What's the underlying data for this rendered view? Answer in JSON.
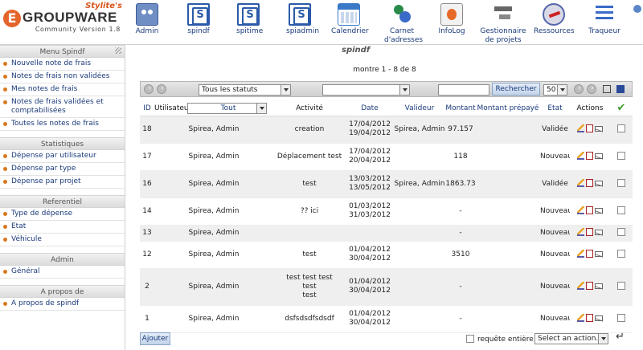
{
  "logo": {
    "tagline": "Stylite's",
    "letter": "E",
    "name": "GROUPWARE",
    "version": "Community Version 1.8"
  },
  "apps": [
    {
      "label": "Admin",
      "icon": "admin-icon"
    },
    {
      "label": "spindf",
      "icon": "spindf-icon"
    },
    {
      "label": "spitime",
      "icon": "spitime-icon"
    },
    {
      "label": "spiadmin",
      "icon": "spiadmin-icon"
    },
    {
      "label": "Calendrier",
      "icon": "calendar-icon"
    },
    {
      "label": "Carnet",
      "label2": "d'adresses",
      "icon": "addressbook-icon"
    },
    {
      "label": "InfoLog",
      "icon": "infolog-icon"
    },
    {
      "label": "Gestionnaire",
      "label2": "de projets",
      "icon": "projectmanager-icon"
    },
    {
      "label": "Ressources",
      "icon": "resources-icon"
    },
    {
      "label": "Traqueur",
      "icon": "tracker-icon"
    }
  ],
  "app_title": "spindf",
  "sidebar": {
    "sections": [
      {
        "title": "Menu Spindf",
        "items": [
          "Nouvelle note de frais",
          "Notes de frais non validées",
          "Mes notes de frais",
          "Notes de frais validées et comptabilisées",
          "Toutes les notes de frais"
        ]
      },
      {
        "title": "Statistiques",
        "items": [
          "Dépense par utilisateur",
          "Dépense par type",
          "Dépense par projet"
        ]
      },
      {
        "title": "Referentiel",
        "items": [
          "Type de dépense",
          "Etat",
          "Véhicule"
        ]
      },
      {
        "title": "Admin",
        "items": [
          "Général"
        ]
      },
      {
        "title": "A propos de",
        "items": [
          "A propos de spindf"
        ]
      }
    ]
  },
  "list": {
    "count_text": "montre 1 - 8 de 8",
    "status_filter": "Tous les statuts",
    "second_filter": "",
    "search_value": "",
    "search_button": "Rechercher",
    "page_size": "50",
    "columns": {
      "id": "ID",
      "user_label": "Utilisateur",
      "user_filter": "Tout",
      "activity": "Activité",
      "date": "Date",
      "validator": "Valideur",
      "amount": "Montant",
      "prepaid": "Montant prépayé",
      "state": "Etat",
      "actions": "Actions",
      "select_all_icon": "checkmark-icon"
    },
    "rows": [
      {
        "id": "18",
        "user": "Spirea, Admin",
        "activity": "creation",
        "date1": "17/04/2012",
        "date2": "19/04/2012",
        "validator": "Spirea, Admin",
        "amount": "97.157",
        "prepaid": "",
        "state": "Validée"
      },
      {
        "id": "17",
        "user": "Spirea, Admin",
        "activity": "Déplacement test",
        "date1": "17/04/2012",
        "date2": "20/04/2012",
        "validator": "",
        "amount": "118",
        "prepaid": "",
        "state": "Nouveau"
      },
      {
        "id": "16",
        "user": "Spirea, Admin",
        "activity": "test",
        "date1": "13/03/2012",
        "date2": "13/05/2012",
        "validator": "Spirea, Admin",
        "amount": "1863.73",
        "prepaid": "",
        "state": "Validée"
      },
      {
        "id": "14",
        "user": "Spirea, Admin",
        "activity": "?? ici",
        "date1": "01/03/2012",
        "date2": "31/03/2012",
        "validator": "",
        "amount": "-",
        "prepaid": "",
        "state": "Nouveau"
      },
      {
        "id": "13",
        "user": "Spirea, Admin",
        "activity": "",
        "date1": "",
        "date2": "",
        "validator": "",
        "amount": "-",
        "prepaid": "",
        "state": "Nouveau"
      },
      {
        "id": "12",
        "user": "Spirea, Admin",
        "activity": "test",
        "date1": "01/04/2012",
        "date2": "30/04/2012",
        "validator": "",
        "amount": "3510",
        "prepaid": "",
        "state": "Nouveau"
      },
      {
        "id": "2",
        "user": "Spirea, Admin",
        "activity": "test test test\ntest\ntest",
        "date1": "01/04/2012",
        "date2": "30/04/2012",
        "validator": "",
        "amount": "-",
        "prepaid": "",
        "state": "Nouveau"
      },
      {
        "id": "1",
        "user": "Spirea, Admin",
        "activity": "dsfsdsdfsdsdf",
        "date1": "01/04/2012",
        "date2": "30/04/2012",
        "validator": "",
        "amount": "-",
        "prepaid": "",
        "state": "Nouveau"
      }
    ],
    "add_button": "Ajouter",
    "whole_query_label": "requête entière",
    "action_select": "Select an action..."
  }
}
